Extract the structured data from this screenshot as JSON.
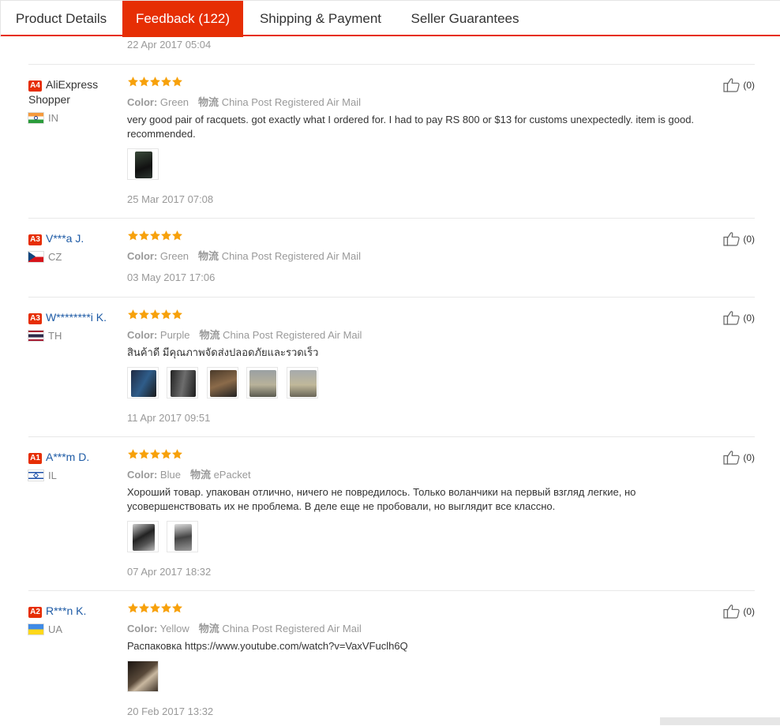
{
  "tabs": [
    {
      "label": "Product Details",
      "active": false
    },
    {
      "label": "Feedback (122)",
      "active": true
    },
    {
      "label": "Shipping & Payment",
      "active": false
    },
    {
      "label": "Seller Guarantees",
      "active": false
    }
  ],
  "top_date": "22 Apr 2017 05:04",
  "labels": {
    "color": "Color:",
    "logistics": "物流"
  },
  "colors": {
    "accent": "#e62e04",
    "star": "#f7a10b",
    "link": "#1d5aa5"
  },
  "reviews": [
    {
      "level": "A4",
      "name": "AliExpress Shopper",
      "country": "IN",
      "flag": "india-flag",
      "color": "Green",
      "logistics": "China Post Registered Air Mail",
      "text": "very good pair of racquets. got exactly what I ordered for. I had to pay RS 800 or $13 for customs unexpectedly. item is good. recommended.",
      "date": "25 Mar 2017 07:08",
      "likes": "(0)",
      "photo_count": 1
    },
    {
      "level": "A3",
      "name": "V***a J.",
      "country": "CZ",
      "flag": "czech-flag",
      "color": "Green",
      "logistics": "China Post Registered Air Mail",
      "text": "",
      "date": "03 May 2017 17:06",
      "likes": "(0)",
      "photo_count": 0
    },
    {
      "level": "A3",
      "name": "W********i K.",
      "country": "TH",
      "flag": "thailand-flag",
      "color": "Purple",
      "logistics": "China Post Registered Air Mail",
      "text": "สินค้าดี มีคุณภาพจัดส่งปลอดภัยและรวดเร็ว",
      "date": "11 Apr 2017 09:51",
      "likes": "(0)",
      "photo_count": 5
    },
    {
      "level": "A1",
      "name": "A***m D.",
      "country": "IL",
      "flag": "israel-flag",
      "color": "Blue",
      "logistics": "ePacket",
      "text": "Хороший товар. упакован отлично, ничего не повредилось. Только воланчики на первый взгляд легкие, но усовершенствовать их не проблема. В деле еще не пробовали, но выглядит все классно.",
      "date": "07 Apr 2017 18:32",
      "likes": "(0)",
      "photo_count": 2
    },
    {
      "level": "A2",
      "name": "R***n K.",
      "country": "UA",
      "flag": "ukraine-flag",
      "color": "Yellow",
      "logistics": "China Post Registered Air Mail",
      "text": "Распаковка https://www.youtube.com/watch?v=VaxVFuclh6Q",
      "date": "20 Feb 2017 13:32",
      "likes": "(0)",
      "photo_count": 1
    }
  ]
}
